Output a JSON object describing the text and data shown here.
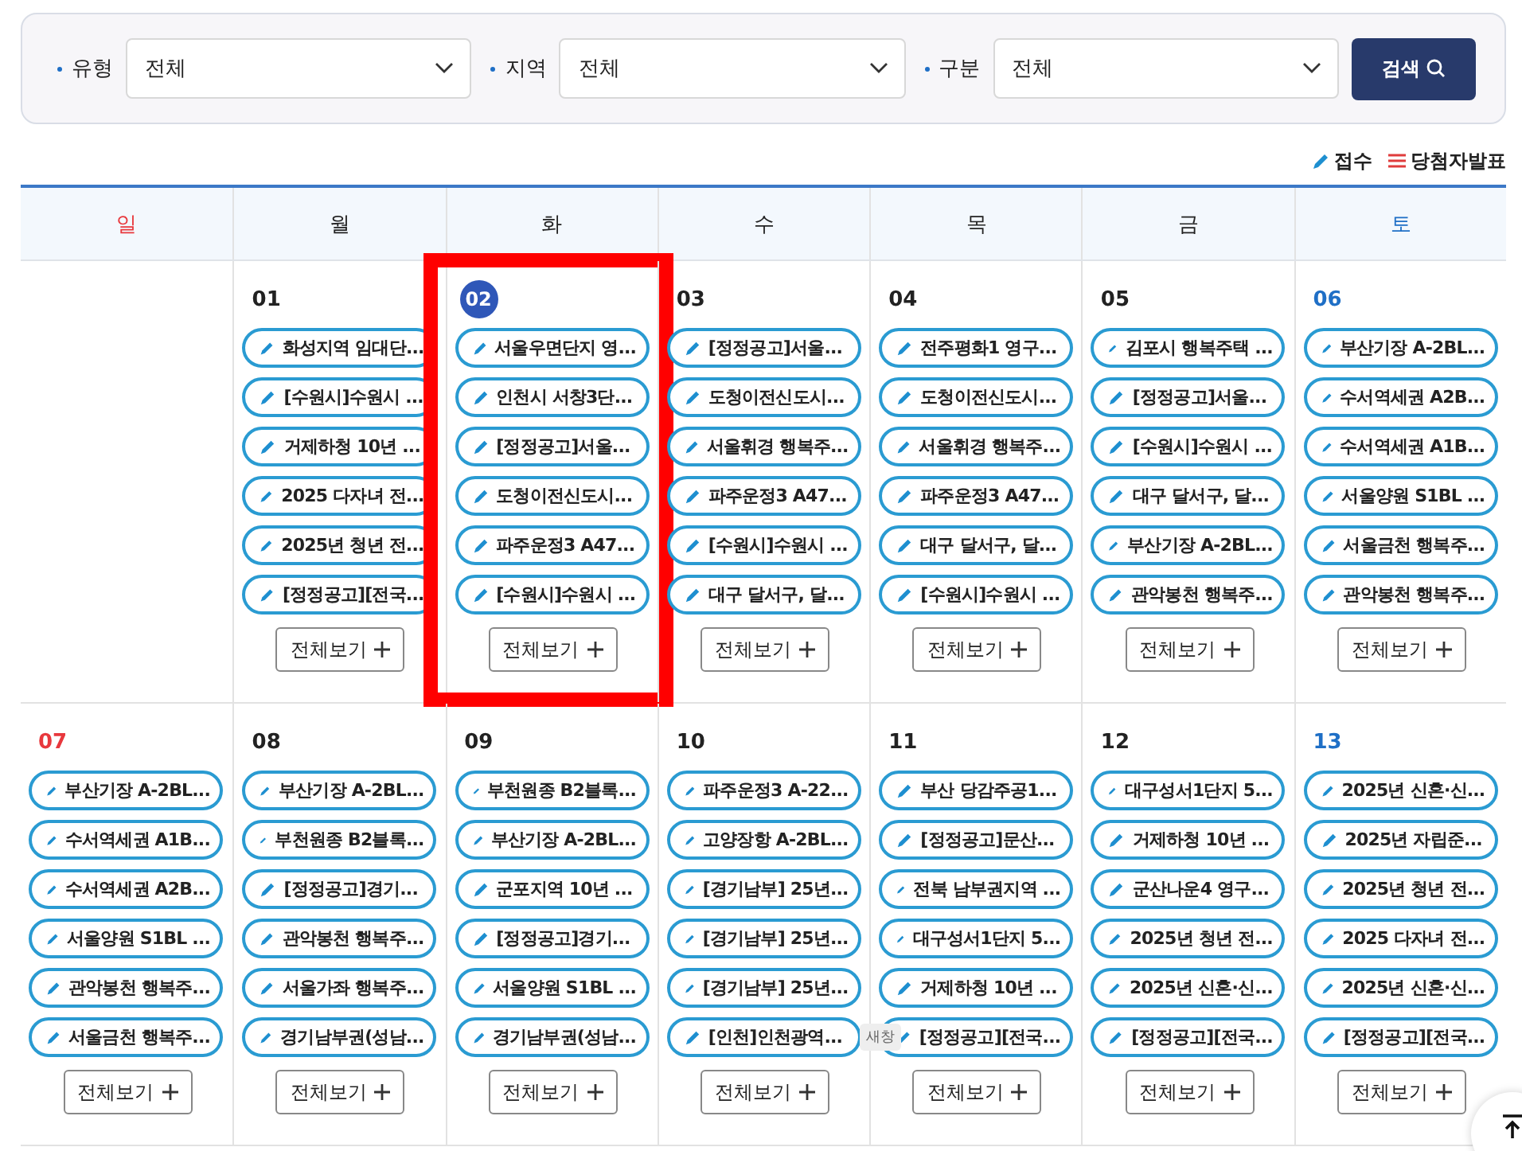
{
  "filters": [
    {
      "label": "유형",
      "value": "전체"
    },
    {
      "label": "지역",
      "value": "전체"
    },
    {
      "label": "구분",
      "value": "전체"
    }
  ],
  "search_button": "검색",
  "legend": [
    {
      "kind": "receipt",
      "label": "접수"
    },
    {
      "kind": "announcement",
      "label": "당첨자발표"
    }
  ],
  "weekdays": [
    {
      "label": "일",
      "kind": "sun"
    },
    {
      "label": "월",
      "kind": "weekday"
    },
    {
      "label": "화",
      "kind": "weekday"
    },
    {
      "label": "수",
      "kind": "weekday"
    },
    {
      "label": "목",
      "kind": "weekday"
    },
    {
      "label": "금",
      "kind": "weekday"
    },
    {
      "label": "토",
      "kind": "sat"
    }
  ],
  "weeks": [
    {
      "days": [
        {
          "kind": "blank"
        },
        {
          "kind": "weekday",
          "date": "01",
          "today": false,
          "highlighted": false,
          "events": [
            "화성지역 임대단...",
            "[수원시]수원시 ...",
            "거제하청 10년 ...",
            "2025 다자녀 전...",
            "2025년 청년 전...",
            "[정정공고][전국..."
          ],
          "more": "전체보기"
        },
        {
          "kind": "weekday",
          "date": "02",
          "today": true,
          "highlighted": true,
          "events": [
            "서울우면단지 영...",
            "인천시 서창3단...",
            "[정정공고]서울...",
            "도청이전신도시...",
            "파주운정3 A47...",
            "[수원시]수원시 ..."
          ],
          "more": "전체보기"
        },
        {
          "kind": "weekday",
          "date": "03",
          "today": false,
          "highlighted": false,
          "events": [
            "[정정공고]서울...",
            "도청이전신도시...",
            "서울휘경 행복주...",
            "파주운정3 A47...",
            "[수원시]수원시 ...",
            "대구 달서구, 달..."
          ],
          "more": "전체보기"
        },
        {
          "kind": "weekday",
          "date": "04",
          "today": false,
          "highlighted": false,
          "events": [
            "전주평화1 영구...",
            "도청이전신도시...",
            "서울휘경 행복주...",
            "파주운정3 A47...",
            "대구 달서구, 달...",
            "[수원시]수원시 ..."
          ],
          "more": "전체보기"
        },
        {
          "kind": "weekday",
          "date": "05",
          "today": false,
          "highlighted": false,
          "events": [
            "김포시 행복주택 ...",
            "[정정공고]서울...",
            "[수원시]수원시 ...",
            "대구 달서구, 달...",
            "부산기장 A-2BL...",
            "관악봉천 행복주..."
          ],
          "more": "전체보기"
        },
        {
          "kind": "sat",
          "date": "06",
          "today": false,
          "highlighted": false,
          "events": [
            "부산기장 A-2BL...",
            "수서역세권 A2B...",
            "수서역세권 A1B...",
            "서울양원 S1BL ...",
            "서울금천 행복주...",
            "관악봉천 행복주..."
          ],
          "more": "전체보기"
        }
      ]
    },
    {
      "days": [
        {
          "kind": "sun",
          "date": "07",
          "today": false,
          "highlighted": false,
          "events": [
            "부산기장 A-2BL...",
            "수서역세권 A1B...",
            "수서역세권 A2B...",
            "서울양원 S1BL ...",
            "관악봉천 행복주...",
            "서울금천 행복주..."
          ],
          "more": "전체보기"
        },
        {
          "kind": "weekday",
          "date": "08",
          "today": false,
          "highlighted": false,
          "events": [
            "부산기장 A-2BL...",
            "부천원종 B2블록...",
            "[정정공고]경기...",
            "관악봉천 행복주...",
            "서울가좌 행복주...",
            "경기남부권(성남..."
          ],
          "more": "전체보기"
        },
        {
          "kind": "weekday",
          "date": "09",
          "today": false,
          "highlighted": false,
          "events": [
            "부천원종 B2블록...",
            "부산기장 A-2BL...",
            "군포지역 10년 ...",
            "[정정공고]경기...",
            "서울양원 S1BL ...",
            "경기남부권(성남..."
          ],
          "more": "전체보기"
        },
        {
          "kind": "weekday",
          "date": "10",
          "today": false,
          "highlighted": false,
          "events": [
            "파주운정3 A-22...",
            "고양장항 A-2BL...",
            "[경기남부] 25년...",
            "[경기남부] 25년...",
            "[경기남부] 25년...",
            "[인천]인천광역..."
          ],
          "more": "전체보기"
        },
        {
          "kind": "weekday",
          "date": "11",
          "today": false,
          "highlighted": false,
          "events": [
            "부산 당감주공1...",
            "[정정공고]문산...",
            "전북 남부권지역 ...",
            "대구성서1단지 5...",
            "거제하청 10년 ...",
            "[정정공고][전국..."
          ],
          "more": "전체보기"
        },
        {
          "kind": "weekday",
          "date": "12",
          "today": false,
          "highlighted": false,
          "events": [
            "대구성서1단지 5...",
            "거제하청 10년 ...",
            "군산나운4 영구...",
            "2025년 청년 전...",
            "2025년 신혼·신...",
            "[정정공고][전국..."
          ],
          "more": "전체보기"
        },
        {
          "kind": "sat",
          "date": "13",
          "today": false,
          "highlighted": false,
          "events": [
            "2025년 신혼·신...",
            "2025년 자립준...",
            "2025년 청년 전...",
            "2025 다자녀 전...",
            "2025년 신혼·신...",
            "[정정공고][전국..."
          ],
          "more": "전체보기"
        }
      ]
    }
  ],
  "tooltip": {
    "text": "새창"
  }
}
